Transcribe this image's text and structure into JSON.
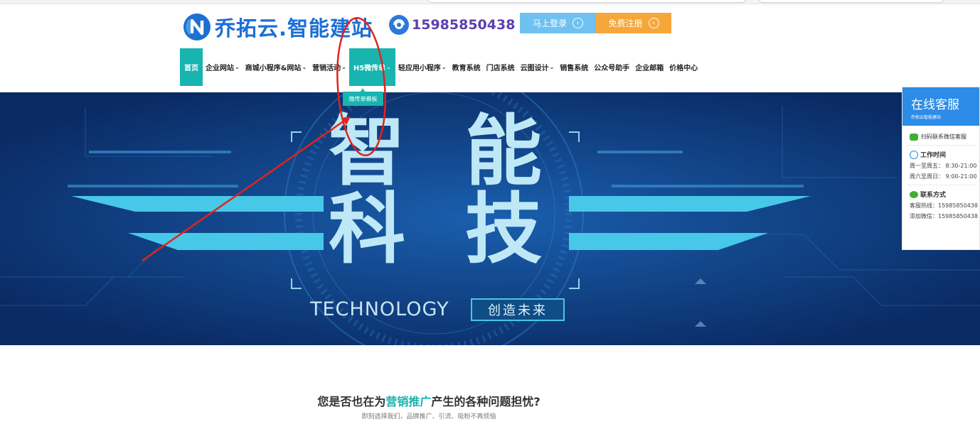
{
  "brand": {
    "name": "乔拓云.智能建站"
  },
  "contact": {
    "phone": "15985850438"
  },
  "auth": {
    "login_label": "马上登录",
    "register_label": "免费注册",
    "arrow": "›"
  },
  "nav": {
    "items": [
      {
        "label": "首页",
        "caret": ""
      },
      {
        "label": "企业网站",
        "caret": "⌄"
      },
      {
        "label": "商城小程序&网站",
        "caret": "⌄"
      },
      {
        "label": "营销活动",
        "caret": "⌄"
      },
      {
        "label": "H5微传单",
        "caret": "⌄"
      },
      {
        "label": "轻应用小程序",
        "caret": "⌄"
      },
      {
        "label": "教育系统",
        "caret": ""
      },
      {
        "label": "门店系统",
        "caret": ""
      },
      {
        "label": "云图设计",
        "caret": "⌄"
      },
      {
        "label": "销售系统",
        "caret": ""
      },
      {
        "label": "公众号助手",
        "caret": ""
      },
      {
        "label": "企业邮箱",
        "caret": ""
      },
      {
        "label": "价格中心",
        "caret": ""
      }
    ],
    "dropdown_item": "微传单模板"
  },
  "banner": {
    "line1": [
      "智",
      "能"
    ],
    "line2": [
      "科",
      "技"
    ],
    "technology": "TECHNOLOGY",
    "slogan": "创造未来",
    "colors": {
      "bg": "#0b3472",
      "accent": "#47c8e8"
    }
  },
  "section": {
    "title_pre": "您是否也在为",
    "title_highlight": "营销推广",
    "title_post": "产生的各种问题担忧?",
    "subtitle": "即刻选择我们，品牌推广、引流、吸粉不再烦恼"
  },
  "service_panel": {
    "title": "在线客服",
    "subtitle": "乔拓云智能建站",
    "wechat_label": "扫码联系微信客服",
    "hours_title": "工作时间",
    "hours": [
      "周一至周五：  8:30-21:00",
      "周六至周日：  9:00-21:00"
    ],
    "contact_title": "联系方式",
    "contacts": [
      "客服热线：15985850438",
      "添加微信：15985850438"
    ]
  },
  "annotation": {
    "color": "#e2231a"
  },
  "theme": {
    "teal": "#18b4b0",
    "blue": "#1b6fd6",
    "login_bg": "#6ec1f0",
    "register_bg": "#f6a73a"
  }
}
